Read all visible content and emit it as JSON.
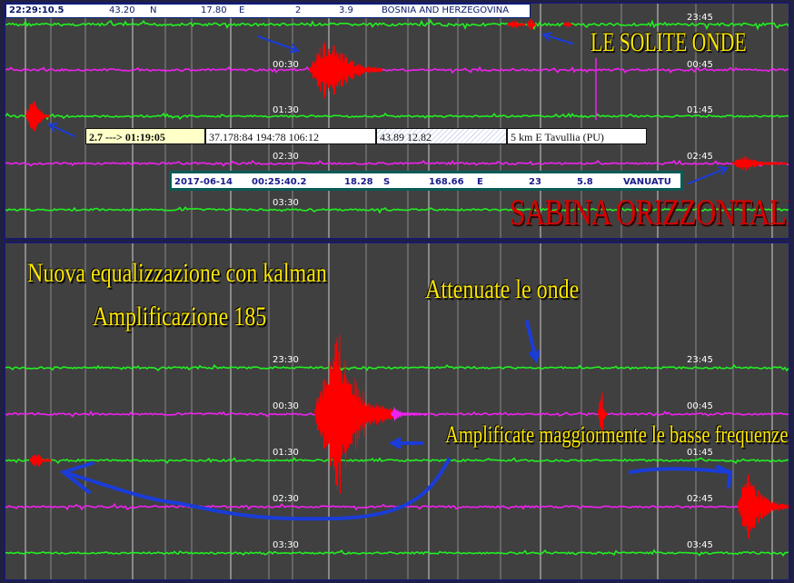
{
  "top_panel": {
    "info_bar": {
      "time": "22:29:10.5",
      "lat": "43.20",
      "lat_dir": "N",
      "lon": "17.80",
      "lon_dir": "E",
      "depth": "2",
      "magnitude": "3.9",
      "region": "BOSNIA AND HERZEGOVINA"
    },
    "time_labels_left": [
      "00:30",
      "01:30",
      "02:30",
      "03:30"
    ],
    "time_labels_right": [
      "23:45",
      "00:45",
      "01:45",
      "02:45"
    ],
    "local_event": {
      "magnitude_time": "2.7 ---> 01:19:05",
      "coords": "37.178:84 194:78 106:12",
      "latlon": "43.89 12.82",
      "location": "5 km E Tavullia (PU)"
    },
    "event_strip": {
      "date": "2017-06-14",
      "time": "00:25:40.2",
      "lat": "18.28",
      "lat_dir": "S",
      "lon": "168.66",
      "lon_dir": "E",
      "depth": "23",
      "magnitude": "5.8",
      "region": "VANUATU"
    },
    "caption": "LE SOLITE ONDE",
    "station_title": "SABINA ORIZZONTALE"
  },
  "bottom_panel": {
    "title_line1": "Nuova equalizzazione con kalman",
    "title_line2": "Amplificazione 185",
    "note_attenuate": "Attenuate le onde",
    "note_amplificate": "Amplificate maggiormente le basse frequenze",
    "time_labels_left": [
      "23:30",
      "00:30",
      "01:30",
      "02:30",
      "03:30"
    ],
    "time_labels_right": [
      "23:45",
      "00:45",
      "01:45",
      "02:45",
      "03:45"
    ]
  },
  "colors": {
    "background": "#404040",
    "trace_green": "#22ee22",
    "trace_magenta": "#ee22ee",
    "signal_red": "#ff0000",
    "annotation_blue": "#1a3cd8",
    "annotation_yellow": "#ffe800",
    "station_red": "#d80000"
  },
  "icons": [
    "arrow-icon",
    "hand-drawn-arrow-icon"
  ]
}
